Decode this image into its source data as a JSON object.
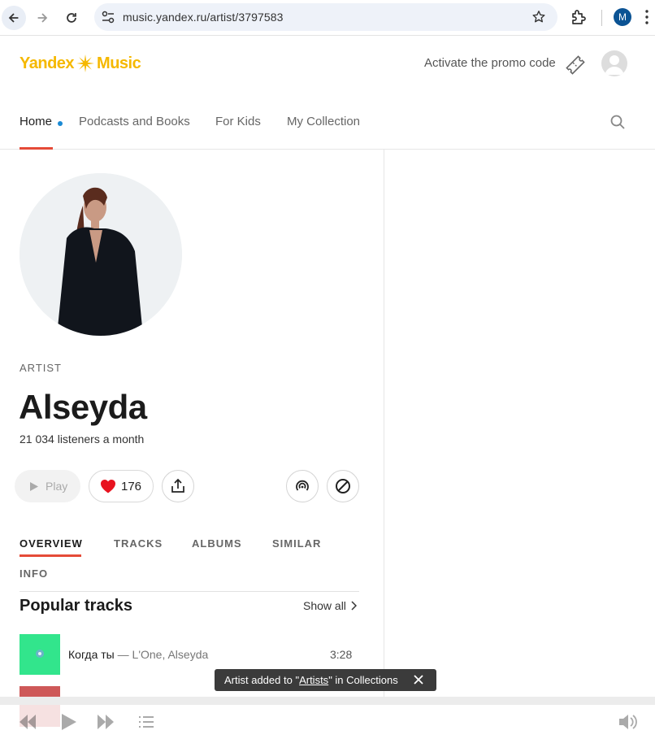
{
  "browser": {
    "url": "music.yandex.ru/artist/3797583",
    "profile_initial": "M"
  },
  "header": {
    "logo_word1": "Yandex",
    "logo_word2": "Music",
    "promo_label": "Activate the promo code"
  },
  "topnav": {
    "items": [
      "Home",
      "Podcasts and Books",
      "For Kids",
      "My Collection"
    ],
    "active": "Home"
  },
  "artist": {
    "type_label": "ARTIST",
    "name": "Alseyda",
    "listeners": "21 034  listeners a month",
    "play_label": "Play",
    "likes": "176"
  },
  "tabs": {
    "items": [
      "OVERVIEW",
      "TRACKS",
      "ALBUMS",
      "SIMILAR",
      "INFO"
    ],
    "active": "OVERVIEW"
  },
  "popular": {
    "title": "Popular tracks",
    "show_all": "Show all",
    "tracks": [
      {
        "title": "Когда ты",
        "artists": "— L'One, Alseyda",
        "duration": "3:28"
      }
    ]
  },
  "toast": {
    "prefix": "Artist added to \"",
    "link": "Artists",
    "suffix": "\" in Collections"
  },
  "colors": {
    "accent": "#e54b38",
    "brand": "#f5b800",
    "like": "#e8131f",
    "dot": "#1a8ad4"
  }
}
